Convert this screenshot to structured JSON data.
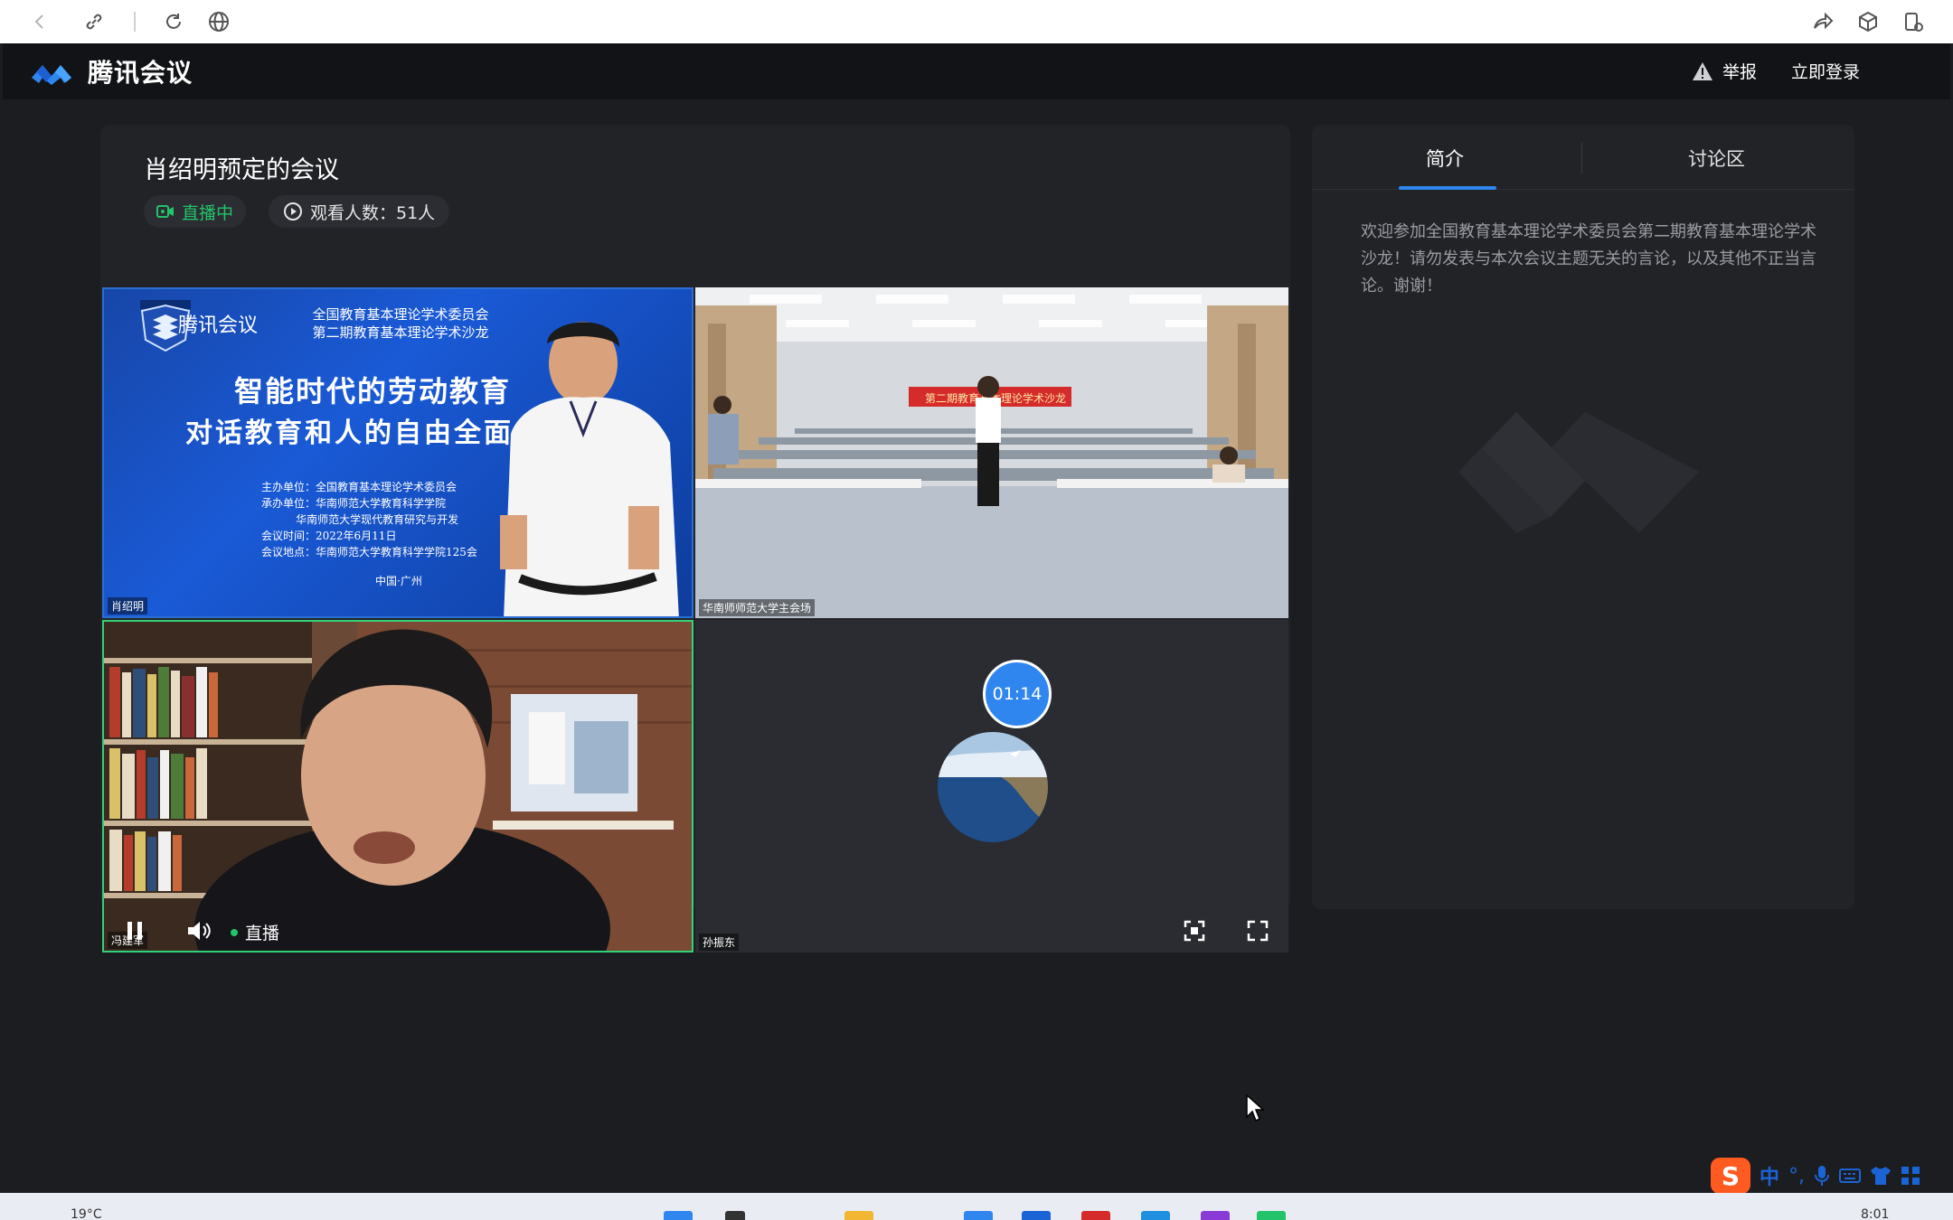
{
  "browser": {
    "icons": [
      "back-icon",
      "link-icon",
      "reload-icon",
      "globe-icon",
      "share-icon",
      "cube-icon",
      "extension-icon"
    ]
  },
  "app": {
    "brand_name": "腾讯会议",
    "report_label": "举报",
    "login_label": "立即登录"
  },
  "meeting": {
    "title": "肖绍明预定的会议",
    "live_badge": "直播中",
    "viewers_label": "观看人数：51人"
  },
  "tiles": {
    "t1": {
      "label": "肖绍明",
      "slide_logo_text": "腾讯会议",
      "slide_org_line1": "全国教育基本理论学术委员会",
      "slide_org_line2": "第二期教育基本理论学术沙龙",
      "slide_title1": "智能时代的劳动教育",
      "slide_title2": "对话教育和人的自由全面",
      "slide_info": "主办单位：全国教育基本理论学术委员会\n承办单位：华南师范大学教育科学学院\n          华南师范大学现代教育研究与开发\n会议时间：2022年6月11日\n会议地点：华南师范大学教育科学学院125会",
      "slide_footer": "中国·广州",
      "banner": "第二期教育基本理论学术沙龙"
    },
    "t2": {
      "label": "华南师师范大学主会场"
    },
    "t3": {
      "label": "冯建军"
    },
    "t4": {
      "label": "孙振东",
      "timer": "01:14"
    }
  },
  "player": {
    "live_label": "直播"
  },
  "side": {
    "tab_intro": "简介",
    "tab_discuss": "讨论区",
    "intro_text": "欢迎参加全国教育基本理论学术委员会第二期教育基本理论学术沙龙！请勿发表与本次会议主题无关的言论，以及其他不正当言论。谢谢！"
  },
  "taskbar": {
    "weather": "19°C",
    "time": "8:01",
    "ime_mode": "中"
  },
  "colors": {
    "accent": "#2f86ef",
    "live_green": "#22c36a",
    "panel": "#222327",
    "background": "#1c1d21"
  }
}
